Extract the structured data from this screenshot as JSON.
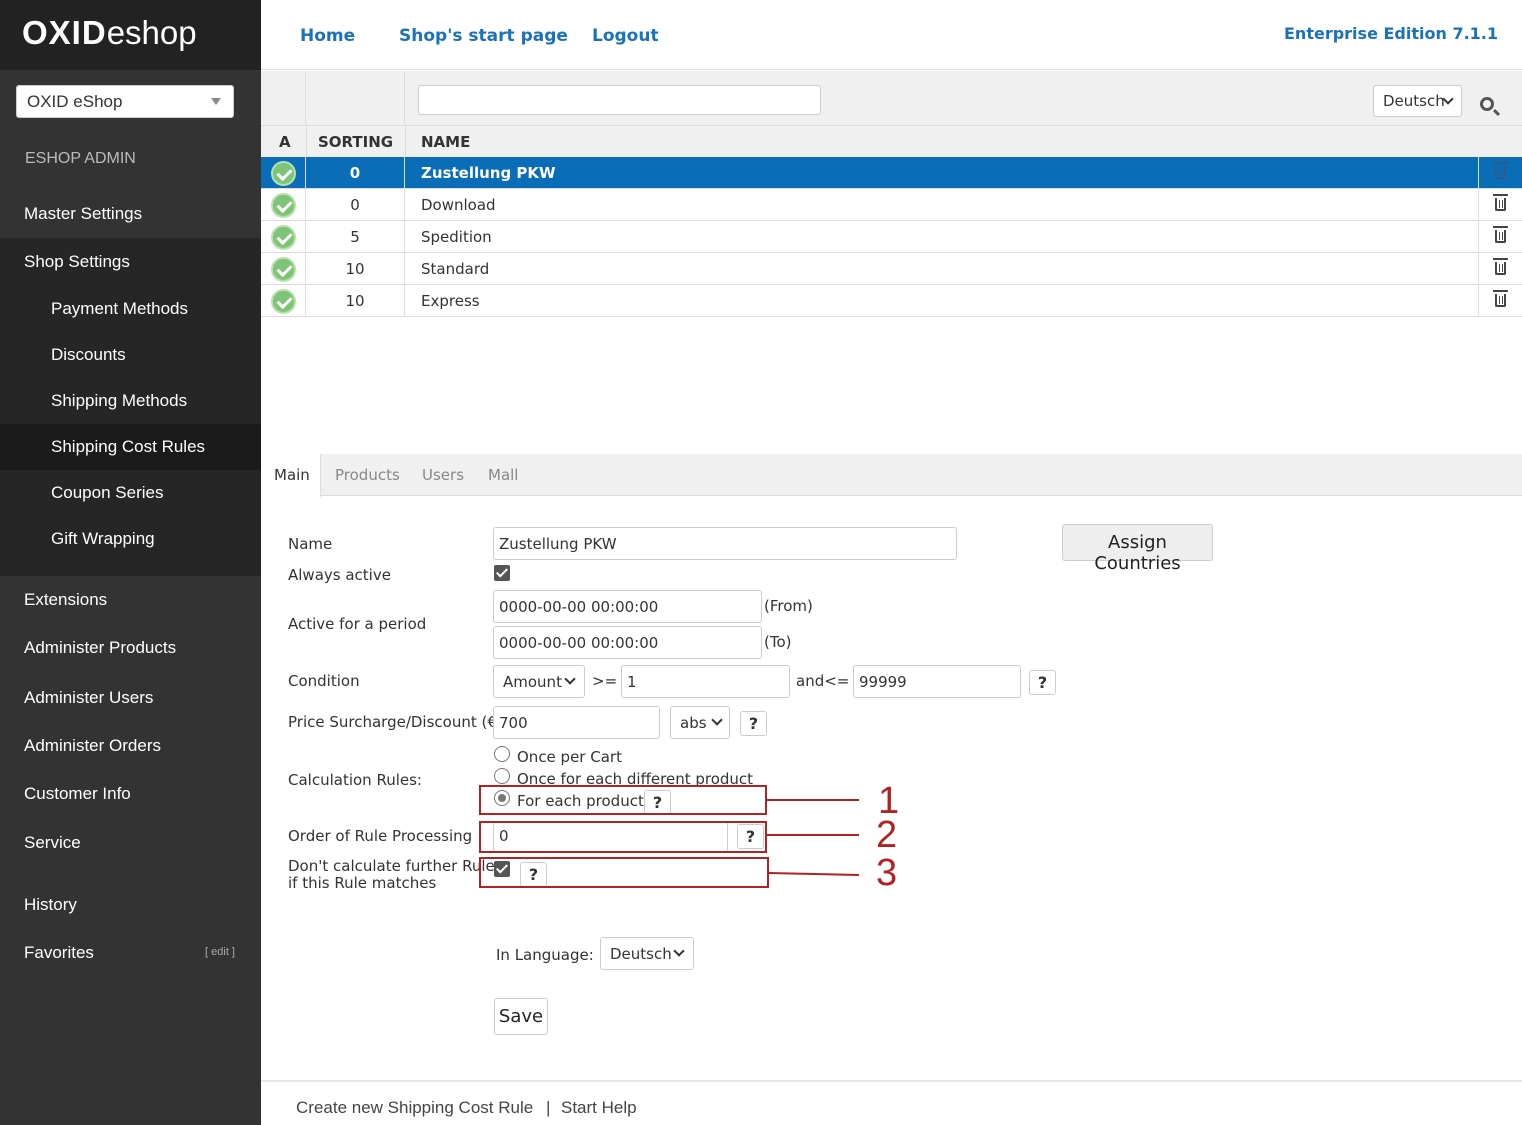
{
  "sidebar": {
    "logo_bold": "OXID",
    "logo_light": "eshop",
    "shop_select": "OXID eShop",
    "admin_title": "ESHOP ADMIN",
    "items": {
      "master_settings": "Master Settings",
      "shop_settings": "Shop Settings",
      "payment_methods": "Payment Methods",
      "discounts": "Discounts",
      "shipping_methods": "Shipping Methods",
      "shipping_cost_rules": "Shipping Cost Rules",
      "coupon_series": "Coupon Series",
      "gift_wrapping": "Gift Wrapping",
      "extensions": "Extensions",
      "administer_products": "Administer Products",
      "administer_users": "Administer Users",
      "administer_orders": "Administer Orders",
      "customer_info": "Customer Info",
      "service": "Service",
      "history": "History",
      "favorites": "Favorites"
    },
    "favorites_edit": "[ edit ]"
  },
  "header": {
    "home": "Home",
    "start_page": "Shop's start page",
    "logout": "Logout",
    "edition": "Enterprise Edition 7.1.1"
  },
  "list": {
    "filter_value": "",
    "language": "Deutsch",
    "columns": {
      "active": "A",
      "sorting": "SORTING",
      "name": "NAME"
    },
    "rows": [
      {
        "sorting": "0",
        "name": "Zustellung PKW"
      },
      {
        "sorting": "0",
        "name": "Download"
      },
      {
        "sorting": "5",
        "name": "Spedition"
      },
      {
        "sorting": "10",
        "name": "Standard"
      },
      {
        "sorting": "10",
        "name": "Express"
      }
    ]
  },
  "tabs": {
    "main": "Main",
    "products": "Products",
    "users": "Users",
    "mall": "Mall"
  },
  "form": {
    "name_label": "Name",
    "name_value": "Zustellung PKW",
    "assign_countries": "Assign Countries",
    "always_active_label": "Always active",
    "period_label": "Active for a period",
    "from_value": "0000-00-00 00:00:00",
    "from_label": "(From)",
    "to_value": "0000-00-00 00:00:00",
    "to_label": "(To)",
    "condition_label": "Condition",
    "condition_type": "Amount",
    "gte": ">=",
    "condition_min": "1",
    "and_lte": "and<=",
    "condition_max": "99999",
    "price_label": "Price Surcharge/Discount (€)",
    "price_value": "700",
    "price_type": "abs",
    "calc_label": "Calculation Rules:",
    "calc_once_cart": "Once per Cart",
    "calc_once_product": "Once for each different product",
    "calc_each_product": "For each product",
    "order_label": "Order of Rule Processing",
    "order_value": "0",
    "dont_calc_label_1": "Don't calculate further Rules",
    "dont_calc_label_2": "if this Rule matches",
    "in_language_label": "In Language:",
    "in_language_value": "Deutsch",
    "save": "Save",
    "help_glyph": "?"
  },
  "annotations": [
    "1",
    "2",
    "3"
  ],
  "footer": {
    "create_new": "Create new Shipping Cost Rule",
    "separator": "|",
    "start_help": "Start Help"
  }
}
